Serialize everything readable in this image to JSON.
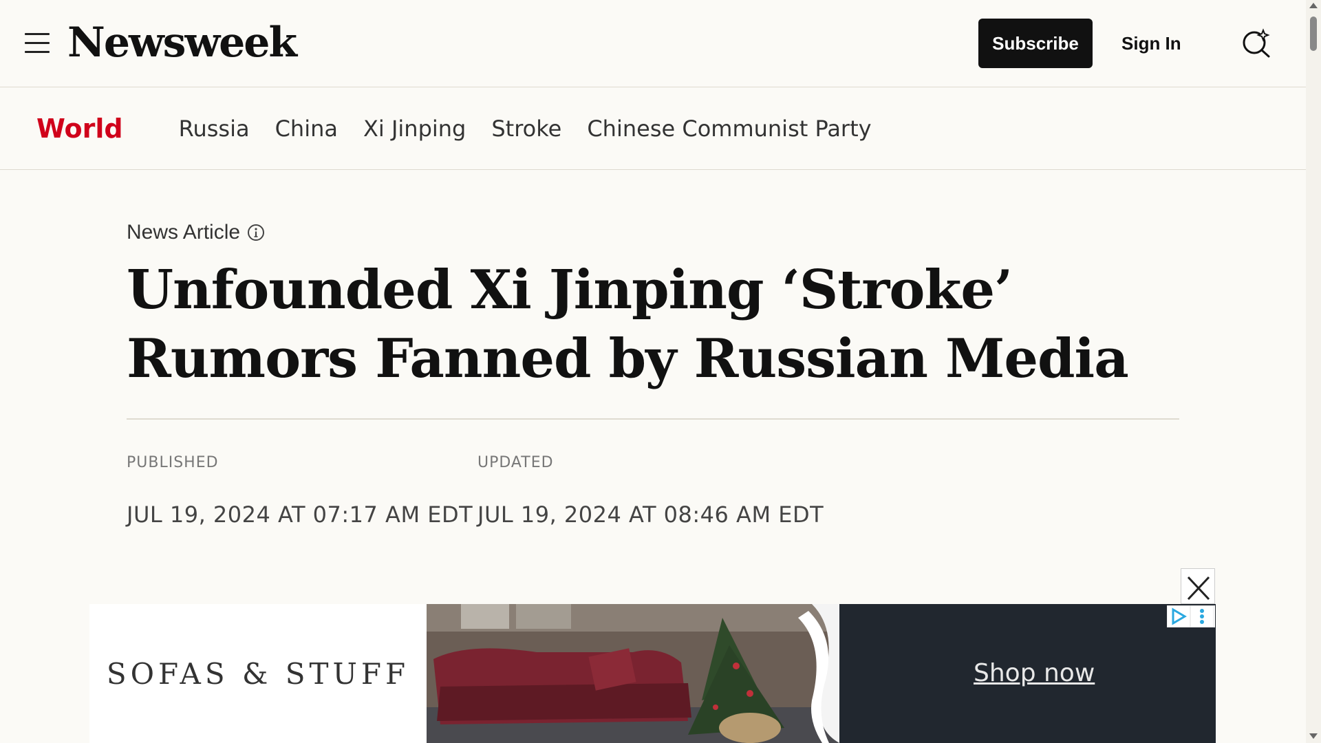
{
  "header": {
    "logo": "Newsweek",
    "subscribe_label": "Subscribe",
    "signin_label": "Sign In"
  },
  "nav": {
    "section": "World",
    "tags": [
      "Russia",
      "China",
      "Xi Jinping",
      "Stroke",
      "Chinese Communist Party"
    ]
  },
  "article": {
    "kicker": "News Article",
    "headline": "Unfounded Xi Jinping ‘Stroke’ Rumors Fanned by Russian Media",
    "published_label": "PUBLISHED",
    "published_value": "JUL 19, 2024 AT 07:17 AM EDT",
    "updated_label": "UPDATED",
    "updated_value": "JUL 19, 2024 AT 08:46 AM EDT"
  },
  "ad": {
    "brand": "SOFAS & STUFF",
    "cta": "Shop now"
  },
  "colors": {
    "accent_red": "#d0021b",
    "background": "#fbfaf6",
    "ad_dark": "#21272f"
  }
}
